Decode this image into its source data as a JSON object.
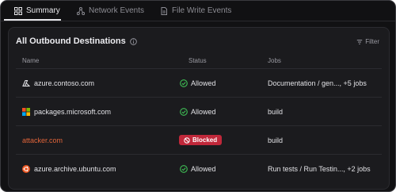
{
  "tabs": [
    {
      "label": "Summary",
      "icon": "grid-icon",
      "active": true
    },
    {
      "label": "Network Events",
      "icon": "network-icon",
      "active": false
    },
    {
      "label": "File Write Events",
      "icon": "file-icon",
      "active": false
    }
  ],
  "panel": {
    "title": "All Outbound Destinations",
    "filter_label": "Filter",
    "columns": {
      "name": "Name",
      "status": "Status",
      "jobs": "Jobs"
    }
  },
  "rows": [
    {
      "name": "azure.contoso.com",
      "icon": "azure-icon",
      "status": "Allowed",
      "jobs": "Documentation / gen..., +5 jobs"
    },
    {
      "name": "packages.microsoft.com",
      "icon": "microsoft-icon",
      "status": "Allowed",
      "jobs": "build"
    },
    {
      "name": "attacker.com",
      "icon": "",
      "status": "Blocked",
      "jobs": "build"
    },
    {
      "name": "azure.archive.ubuntu.com",
      "icon": "ubuntu-icon",
      "status": "Allowed",
      "jobs": "Run tests / Run Testin..., +2 jobs"
    }
  ],
  "colors": {
    "background": "#111113",
    "panel": "#1b1b1e",
    "allowed": "#3fbf55",
    "blocked": "#c0283a",
    "danger_text": "#e0643a"
  }
}
